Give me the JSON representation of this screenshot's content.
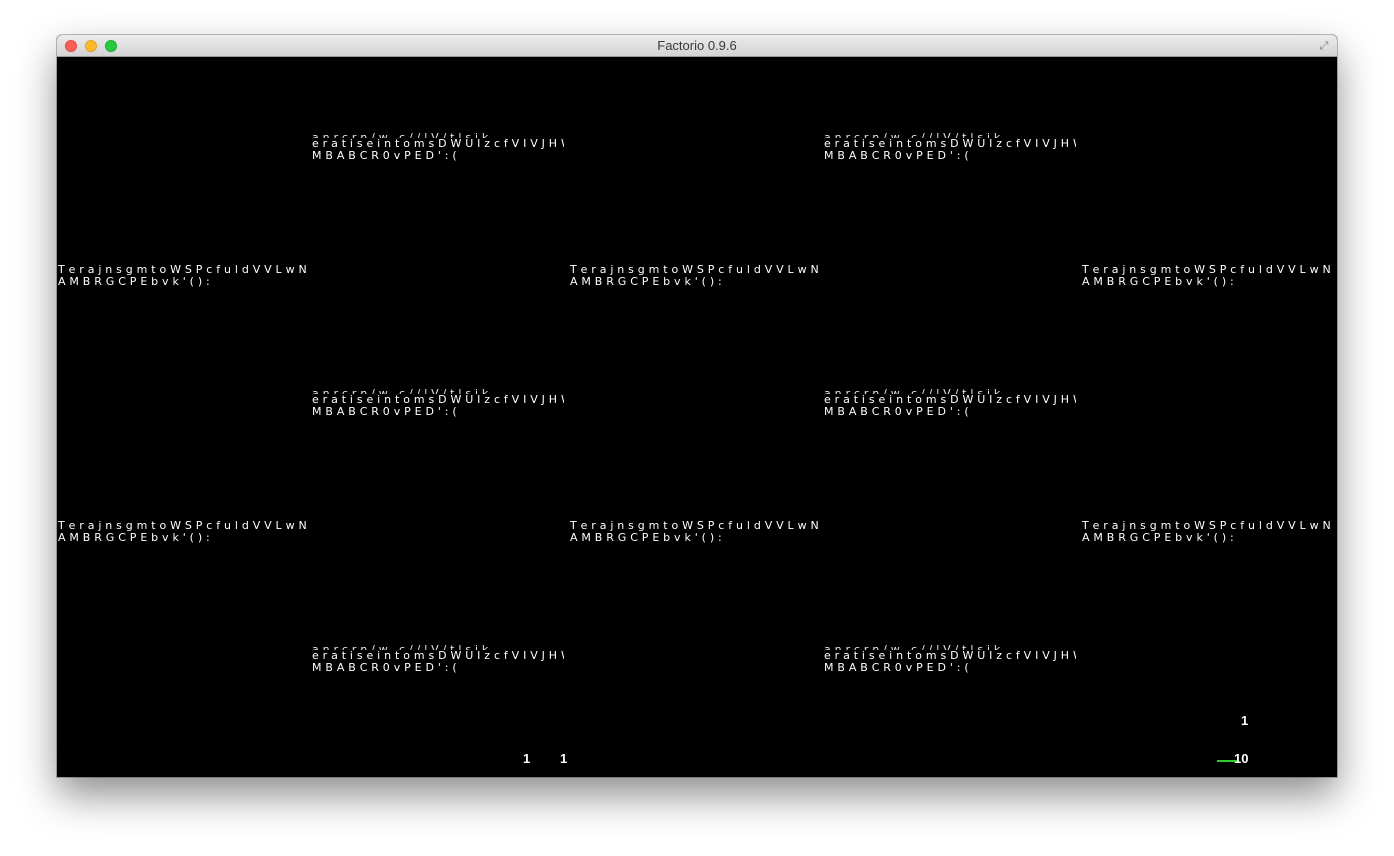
{
  "window": {
    "title": "Factorio 0.9.6"
  },
  "font_atlas": {
    "set_a": {
      "line1": "T e r a j n s g  m t o W  S P c f u l d V  V L w N  H  h O I",
      "line2": "A  M B R  G C P E b v k ' (  ) :"
    },
    "set_b": {
      "line0": "a n  r  c r n  / w  . c  /  /  l  V  /  t  l  s  i  k",
      "line1": "e r a t  i s e i n t  o  m s D W  U I z c f  V I  V  J  H W m  I  h r",
      "line2": "M B A  B C R  0 v P E D ' : ("
    }
  },
  "hud": {
    "count_left_a": "1",
    "count_left_b": "1",
    "count_right_top": "1",
    "count_right_bottom": "10",
    "accent_color": "#2ecc2e"
  }
}
